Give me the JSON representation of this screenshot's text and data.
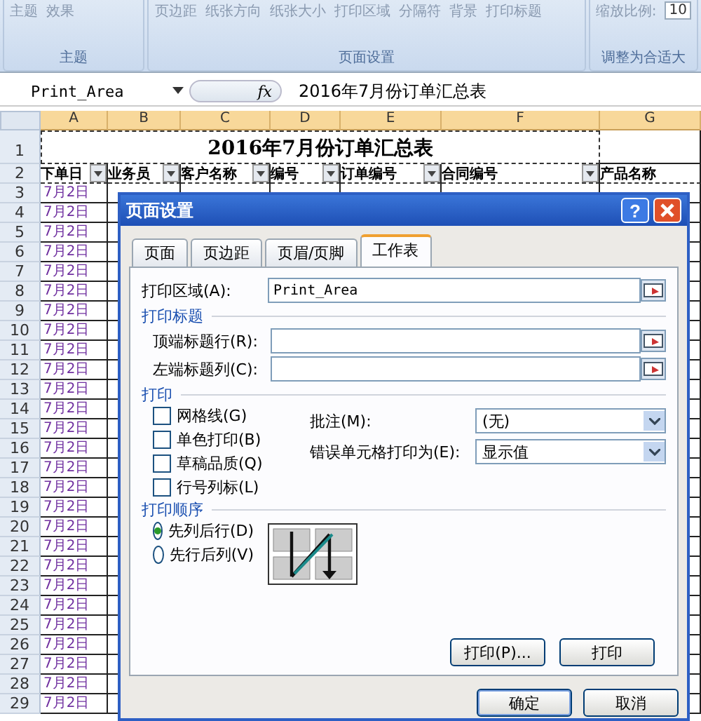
{
  "ribbon": {
    "groups": [
      {
        "label": "主题",
        "buttons": [
          "主题",
          "效果"
        ]
      },
      {
        "label": "页面设置",
        "buttons": [
          "页边距",
          "纸张方向",
          "纸张大小",
          "打印区域",
          "分隔符",
          "背景",
          "打印标题"
        ]
      },
      {
        "label": "调整为合适大",
        "buttons": [
          "缩放比例:"
        ],
        "value": "10"
      }
    ]
  },
  "formula_bar": {
    "name_box": "Print_Area",
    "fx": "fx",
    "formula": "2016年7月份订单汇总表"
  },
  "sheet": {
    "columns": [
      "A",
      "B",
      "C",
      "D",
      "E",
      "F",
      "G"
    ],
    "title_row": {
      "number": "1",
      "title": "2016年7月份订单汇总表"
    },
    "header_row": {
      "number": "2",
      "headers": [
        {
          "label": "下单日",
          "filter": true
        },
        {
          "label": "业务员",
          "filter": true
        },
        {
          "label": "客户名称",
          "filter": true
        },
        {
          "label": "编号",
          "filter": true
        },
        {
          "label": "订单编号",
          "filter": true
        },
        {
          "label": "合同编号",
          "filter": true
        },
        {
          "label": "产品名称",
          "filter": false
        }
      ]
    },
    "rows": [
      {
        "number": "3",
        "date": "7月2日"
      },
      {
        "number": "4",
        "date": "7月2日"
      },
      {
        "number": "5",
        "date": "7月2日"
      },
      {
        "number": "6",
        "date": "7月2日"
      },
      {
        "number": "7",
        "date": "7月2日"
      },
      {
        "number": "8",
        "date": "7月2日"
      },
      {
        "number": "9",
        "date": "7月2日"
      },
      {
        "number": "10",
        "date": "7月2日"
      },
      {
        "number": "11",
        "date": "7月2日"
      },
      {
        "number": "12",
        "date": "7月2日"
      },
      {
        "number": "13",
        "date": "7月2日"
      },
      {
        "number": "14",
        "date": "7月2日"
      },
      {
        "number": "15",
        "date": "7月2日"
      },
      {
        "number": "16",
        "date": "7月2日"
      },
      {
        "number": "17",
        "date": "7月2日"
      },
      {
        "number": "18",
        "date": "7月2日"
      },
      {
        "number": "19",
        "date": "7月2日"
      },
      {
        "number": "20",
        "date": "7月2日"
      },
      {
        "number": "21",
        "date": "7月2日"
      },
      {
        "number": "22",
        "date": "7月2日"
      },
      {
        "number": "23",
        "date": "7月2日"
      },
      {
        "number": "24",
        "date": "7月2日"
      },
      {
        "number": "25",
        "date": "7月2日"
      },
      {
        "number": "26",
        "date": "7月2日"
      },
      {
        "number": "27",
        "date": "7月2日"
      },
      {
        "number": "28",
        "date": "7月2日"
      },
      {
        "number": "29",
        "date": "7月2日"
      }
    ]
  },
  "dialog": {
    "title": "页面设置",
    "help": "?",
    "tabs": [
      {
        "label": "页面",
        "selected": false
      },
      {
        "label": "页边距",
        "selected": false
      },
      {
        "label": "页眉/页脚",
        "selected": false
      },
      {
        "label": "工作表",
        "selected": true
      }
    ],
    "print_area": {
      "label": "打印区域(A):",
      "value": "Print_Area"
    },
    "print_titles": {
      "heading": "打印标题",
      "fields": [
        {
          "label": "顶端标题行(R):"
        },
        {
          "label": "左端标题列(C):"
        }
      ]
    },
    "print": {
      "heading": "打印",
      "checkboxes": [
        {
          "label": "网格线(G)",
          "checked": false
        },
        {
          "label": "单色打印(B)",
          "checked": false
        },
        {
          "label": "草稿品质(Q)",
          "checked": false
        },
        {
          "label": "行号列标(L)",
          "checked": false
        }
      ],
      "dropdowns": [
        {
          "label": "批注(M):",
          "value": "(无)"
        },
        {
          "label": "错误单元格打印为(E):",
          "value": "显示值"
        }
      ]
    },
    "print_order": {
      "heading": "打印顺序",
      "options": [
        {
          "label": "先列后行(D)",
          "selected": true
        },
        {
          "label": "先行后列(V)",
          "selected": false
        }
      ]
    },
    "panel_buttons": [
      "打印(P)...",
      "打印"
    ],
    "buttons": [
      "确定",
      "取消"
    ]
  }
}
